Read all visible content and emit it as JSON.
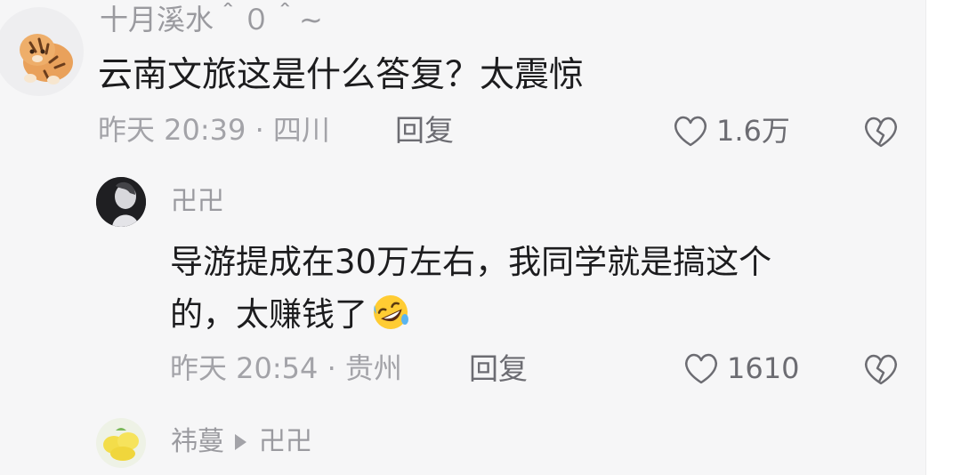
{
  "comment1": {
    "username": "十月溪水＾０＾~",
    "content": "云南文旅这是什么答复？太震惊",
    "meta": "昨天 20:39 · 四川",
    "reply_label": "回复",
    "like_count": "1.6万"
  },
  "reply1": {
    "username": "卍卍",
    "content_line1": "导游提成在30万左右，我同学就是搞这个",
    "content_line2": "的，太赚钱了",
    "emoji": "rolling-on-floor-laughing-emoji",
    "meta": "昨天 20:54 · 贵州",
    "reply_label": "回复",
    "like_count": "1610"
  },
  "reply2": {
    "username": "祎蔓",
    "reply_to": "卍卍"
  },
  "colors": {
    "background": "#f6f6f7",
    "text_primary": "#1c1c1e",
    "text_secondary": "#a3a3a8",
    "action_text": "#6c6c72"
  }
}
